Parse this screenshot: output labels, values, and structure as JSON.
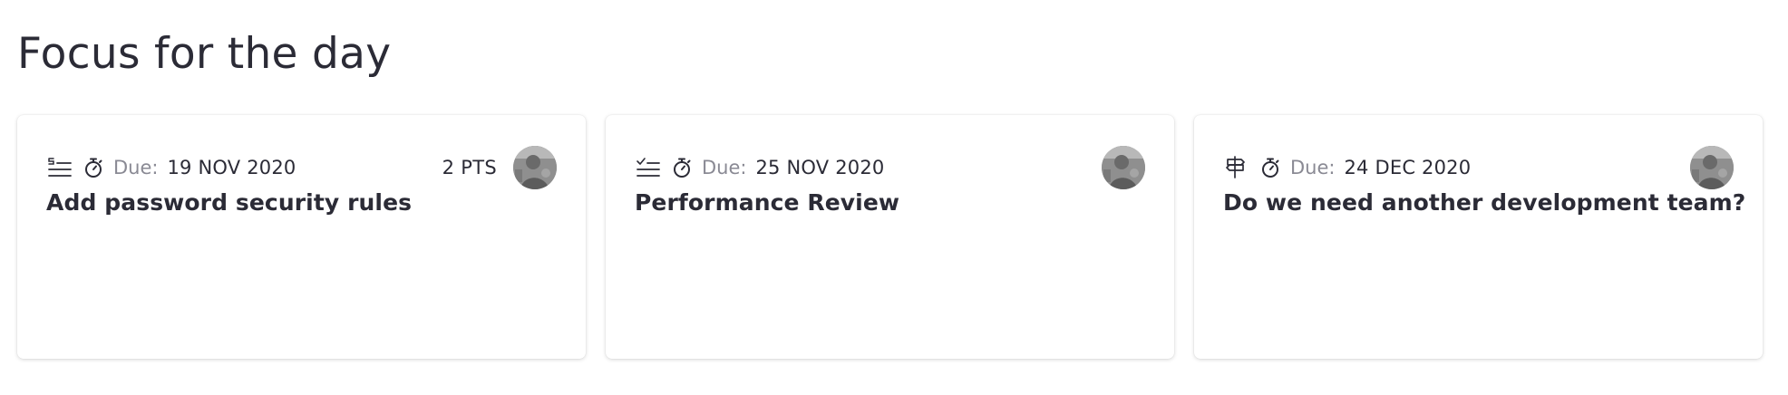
{
  "page": {
    "title": "Focus for the day"
  },
  "cards": [
    {
      "type_icon": "story-icon",
      "timer_icon": "stopwatch-icon",
      "due_label": "Due:",
      "due_date": "19 NOV 2020",
      "points": "2 PTS",
      "title": "Add password security rules",
      "avatar": "user-avatar"
    },
    {
      "type_icon": "checklist-icon",
      "timer_icon": "stopwatch-icon",
      "due_label": "Due:",
      "due_date": "25 NOV 2020",
      "points": "",
      "title": "Performance Review",
      "avatar": "user-avatar"
    },
    {
      "type_icon": "signpost-icon",
      "timer_icon": "stopwatch-icon",
      "due_label": "Due:",
      "due_date": "24 DEC 2020",
      "points": "",
      "title": "Do we need another development team?",
      "avatar": "user-avatar"
    }
  ],
  "colors": {
    "text": "#2b2b36",
    "muted": "#8a8a94",
    "card_bg": "#ffffff"
  }
}
